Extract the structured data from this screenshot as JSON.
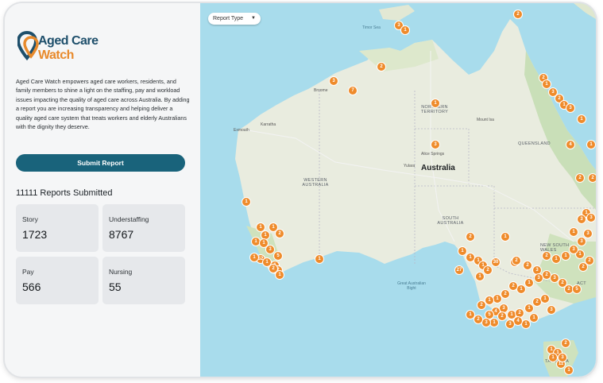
{
  "brand": {
    "line1": "Aged Care",
    "line2": "Watch",
    "colors": {
      "primary": "#1e4f6b",
      "accent": "#e88a2c"
    }
  },
  "description": "Aged Care Watch empowers aged care workers, residents, and family members to shine a light on the staffing, pay and workload issues impacting the quality of aged care across Australia. By adding a report you are increasing transparency and helping deliver a quality aged care system that treats workers and elderly Australians with the dignity they deserve.",
  "submit_button": {
    "label": "Submit Report",
    "color": "#19637b"
  },
  "reports_count": "11111 Reports Submitted",
  "stats": [
    {
      "label": "Story",
      "value": "1723"
    },
    {
      "label": "Understaffing",
      "value": "8767"
    },
    {
      "label": "Pay",
      "value": "566"
    },
    {
      "label": "Nursing",
      "value": "55"
    }
  ],
  "map": {
    "filter": {
      "label": "Report Type",
      "icon": "caret-down-icon"
    },
    "labels": {
      "country": "Australia",
      "nt": "NORTHERN TERRITORY",
      "wa": "WESTERN AUSTRALIA",
      "sa": "SOUTH AUSTRALIA",
      "qld": "QUEENSLAND",
      "nsw": "NEW SOUTH WALES",
      "act": "ACT",
      "tas": "TASMANIA",
      "timor": "Timor Sea",
      "bight": "Great Australian Bight",
      "broome": "Broome",
      "exmouth": "Exmouth",
      "karratha": "Karratha",
      "alice": "Alice Springs",
      "yulara": "Yulara",
      "mount_isa": "Mount Isa"
    },
    "markers": [
      "4",
      "2",
      "3",
      "2",
      "7",
      "3",
      "1",
      "2",
      "1",
      "3",
      "2",
      "1",
      "3",
      "1",
      "4",
      "1",
      "2",
      "2",
      "1",
      "3",
      "3",
      "1",
      "3",
      "3",
      "1",
      "1",
      "1",
      "2",
      "1",
      "1",
      "1",
      "3",
      "5",
      "52",
      "1",
      "1",
      "2",
      "1",
      "2",
      "1",
      "1",
      "3",
      "1",
      "2",
      "1",
      "1",
      "1",
      "1",
      "2",
      "1",
      "5",
      "27",
      "30",
      "2",
      "2",
      "3",
      "2",
      "3",
      "2",
      "2",
      "5",
      "2",
      "2",
      "1",
      "3",
      "1",
      "1",
      "2",
      "3",
      "1",
      "1",
      "2",
      "2",
      "1",
      "1",
      "2",
      "3",
      "4",
      "5",
      "3",
      "1",
      "2",
      "1",
      "2",
      "1",
      "3",
      "1",
      "1",
      "4",
      "3",
      "2",
      "1",
      "3",
      "2",
      "1",
      "1",
      "1",
      "2",
      "1",
      "11",
      "1",
      "3",
      "2",
      "1"
    ]
  }
}
